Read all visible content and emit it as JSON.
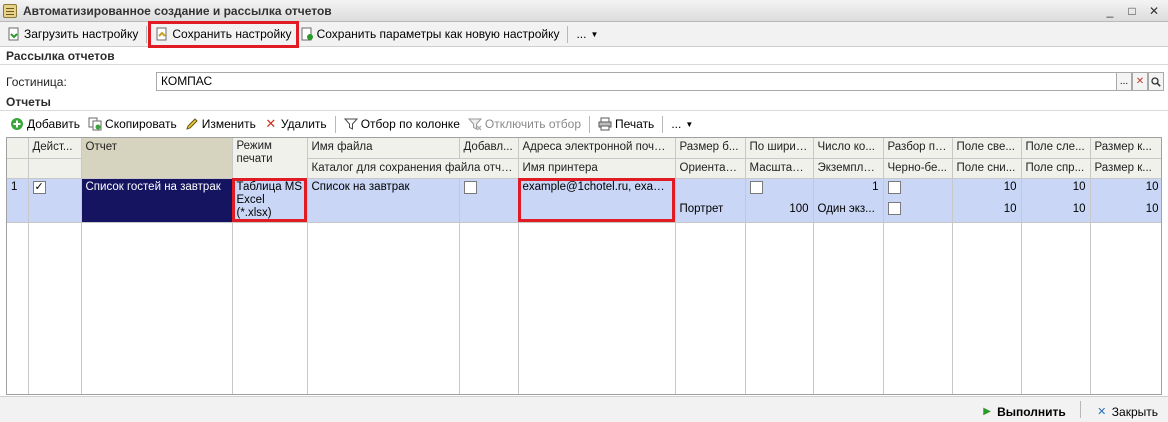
{
  "window": {
    "title": "Автоматизированное создание и рассылка отчетов",
    "controls": {
      "minimize": "_",
      "maximize": "□",
      "close": "✕"
    }
  },
  "toolbar": {
    "load_label": "Загрузить настройку",
    "save_label": "Сохранить настройку",
    "save_as_new_label": "Сохранить параметры как новую настройку",
    "more_label": "..."
  },
  "section_mailing": {
    "title": "Рассылка отчетов"
  },
  "hotel_field": {
    "label": "Гостиница:",
    "value": "КОМПАС",
    "btn_more": "...",
    "btn_clear": "✕",
    "btn_search": "🔍"
  },
  "section_reports": {
    "title": "Отчеты"
  },
  "reports_toolbar": {
    "add_label": "Добавить",
    "copy_label": "Скопировать",
    "edit_label": "Изменить",
    "delete_label": "Удалить",
    "filter_label": "Отбор по колонке",
    "unfilter_label": "Отключить отбор",
    "print_label": "Печать",
    "more_label": "..."
  },
  "table": {
    "header_row1": [
      "",
      "Дейст...",
      "Отчет",
      "Режим печати",
      "Имя файла",
      "Добавл...",
      "Адреса электронной почты...",
      "Размер б...",
      "По ширин...",
      "Число ко...",
      "Разбор по...",
      "Поле све...",
      "Поле сле...",
      "Размер к..."
    ],
    "header_row2": [
      "",
      "",
      "",
      "",
      "Каталог для сохранения файла отчета",
      "",
      "Имя принтера",
      "Ориентац...",
      "Масштаб ...",
      "Экземпля...",
      "Черно-бе...",
      "Поле сни...",
      "Поле спр...",
      "Размер к..."
    ],
    "row": {
      "index": "1",
      "report": "Список гостей на завтрак",
      "print_mode": "Таблица MS Excel (*.xlsx)",
      "file_name": "Список на завтрак",
      "emails": "example@1chotel.ru, exampl...",
      "orientation": "Портрет",
      "scale": "100",
      "copies_top": "1",
      "copies_bottom": "Один экз...",
      "margin_top_a": "10",
      "margin_top_b": "10",
      "margin_left_a": "10",
      "margin_left_b": "10",
      "size_a": "10",
      "size_b": "10"
    }
  },
  "status": {
    "run_label": "Выполнить",
    "close_label": "Закрыть"
  },
  "colors": {
    "highlight": "#e01b24",
    "selected_cell": "#141460",
    "row_bg": "#c9d6f5"
  }
}
